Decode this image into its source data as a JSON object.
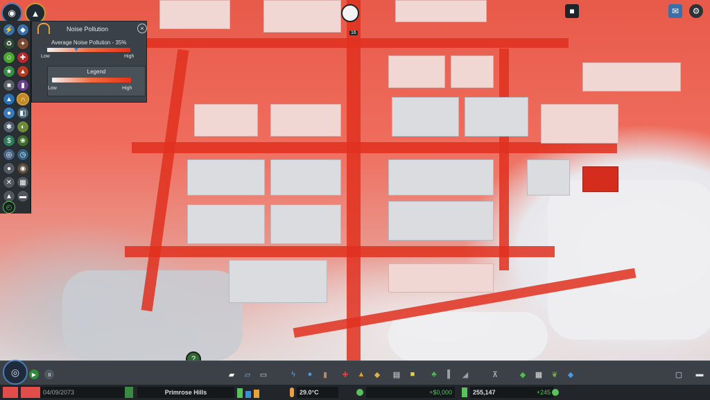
{
  "noise_panel": {
    "title": "Noise Pollution",
    "average_label": "Average Noise Pollution - 35%",
    "average_percent": 35,
    "low_label": "Low",
    "high_label": "High",
    "legend_title": "Legend",
    "legend_low": "Low",
    "legend_high": "High"
  },
  "map": {
    "poi_badge": "16"
  },
  "bottom_bar": {
    "date": "04/09/2073",
    "district": "Primrose Hills",
    "temperature": "29.0°C",
    "money": "+$0,000",
    "population": "255,147",
    "population_change": "+245"
  },
  "icons": {
    "toolbar_top": [
      "city-menu-icon",
      "info-icon"
    ],
    "top_right": [
      "camera-icon",
      "chirper-icon",
      "gear-icon"
    ],
    "hint": "question-icon"
  },
  "colors": {
    "accent": "#e8311a",
    "panel_bg": "#3a4148",
    "positive": "#59c35a",
    "alert": "#e04d4a"
  }
}
